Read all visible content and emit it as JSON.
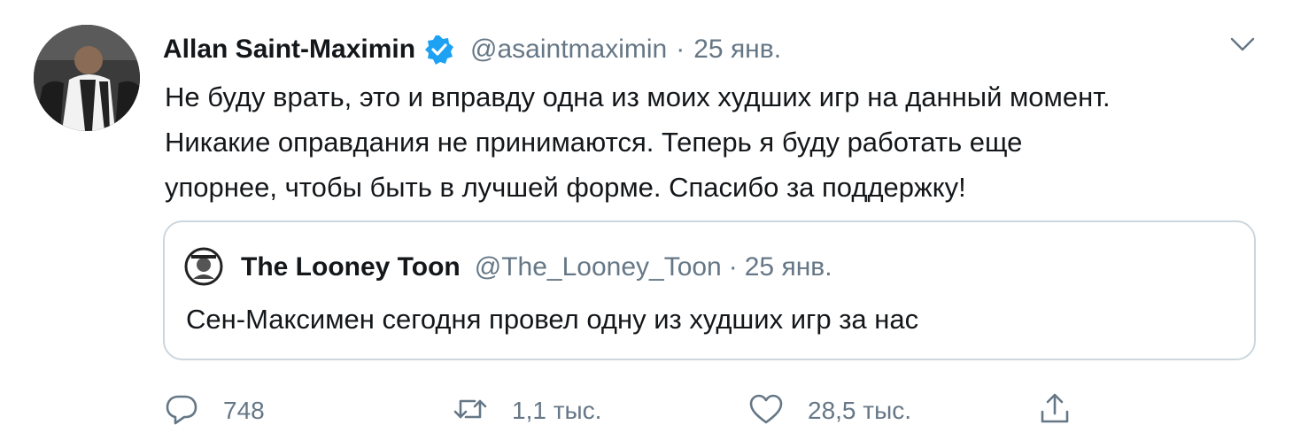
{
  "tweet": {
    "author": {
      "display_name": "Allan Saint-Maximin",
      "verified": true,
      "handle": "@asaintmaximin"
    },
    "separator": "·",
    "date": "25 янв.",
    "text_lines": [
      "Не буду врать, это и вправду одна из моих худших игр на данный момент.",
      "Никакие оправдания не принимаются. Теперь я буду работать еще",
      "упорнее, чтобы быть в лучшей форме. Спасибо за поддержку!"
    ],
    "quoted": {
      "display_name": "The Looney Toon",
      "handle": "@The_Looney_Toon",
      "separator": "·",
      "date": "25 янв.",
      "text": "Сен-Максимен сегодня провел одну из худших игр за нас"
    },
    "actions": {
      "reply_count": "748",
      "retweet_count": "1,1 тыс.",
      "like_count": "28,5 тыс."
    }
  },
  "icons": {
    "verified": "verified-badge-icon",
    "caret": "chevron-down-icon",
    "reply": "reply-icon",
    "retweet": "retweet-icon",
    "like": "heart-icon",
    "share": "share-icon"
  },
  "colors": {
    "text": "#14171a",
    "secondary": "#657786",
    "verified": "#1da1f2",
    "border": "#ccd6dd"
  }
}
